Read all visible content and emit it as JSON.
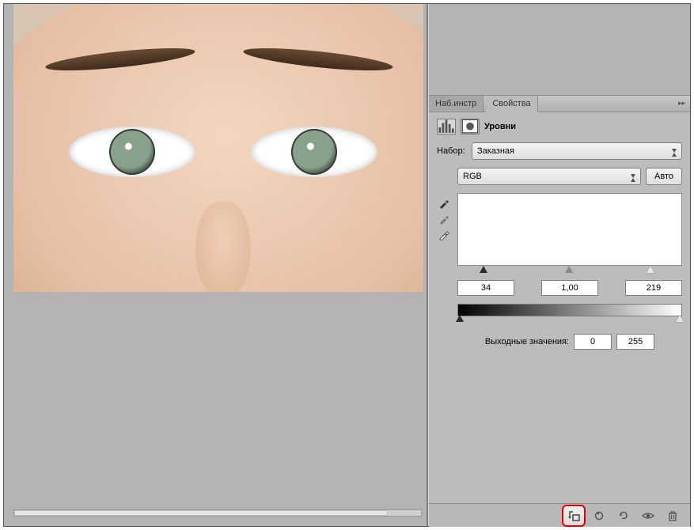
{
  "tabs": {
    "tooltips": "Наб.инстр",
    "properties": "Свойства"
  },
  "panel": {
    "adjustment_name": "Уровни",
    "preset_label": "Набор:",
    "preset_value": "Заказная",
    "channel_value": "RGB",
    "auto_button": "Авто",
    "input_black": "34",
    "input_gamma": "1,00",
    "input_white": "219",
    "output_label": "Выходные значения:",
    "output_black": "0",
    "output_white": "255"
  },
  "icons": {
    "histogram": "histogram-icon",
    "mask": "mask-icon",
    "eyedropper_black": "eyedropper-black",
    "eyedropper_gray": "eyedropper-gray",
    "eyedropper_white": "eyedropper-white",
    "clip": "clip-to-layer-icon",
    "prev": "previous-state-icon",
    "reset": "reset-icon",
    "visibility": "visibility-icon",
    "trash": "trash-icon",
    "flyout": "flyout-menu-icon"
  }
}
